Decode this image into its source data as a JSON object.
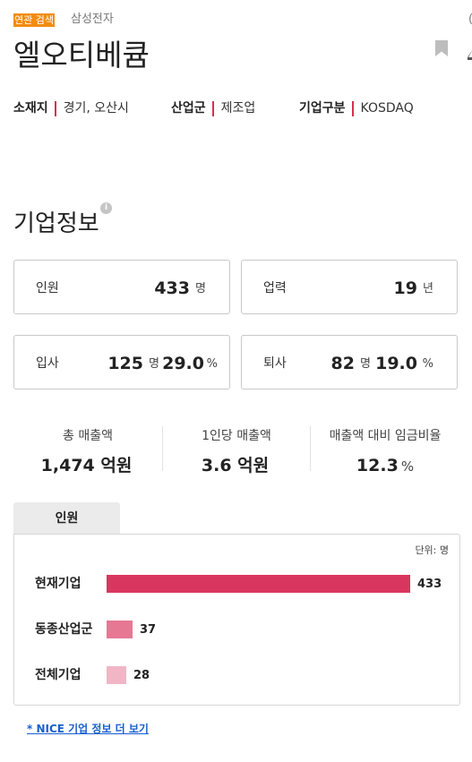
{
  "header": {
    "related_tag": "연관 검색",
    "related_company": "삼성전자",
    "cut_off_text": "(",
    "company_name": "엘오티베큠"
  },
  "meta": [
    {
      "key": "소재지",
      "value": "경기, 오산시"
    },
    {
      "key": "산업군",
      "value": "제조업"
    },
    {
      "key": "기업구분",
      "value": "KOSDAQ"
    }
  ],
  "company_info": {
    "title": "기업정보",
    "info_icon_glyph": "i",
    "boxes": {
      "employees": {
        "label": "인원",
        "value": "433",
        "unit": "명"
      },
      "years": {
        "label": "업력",
        "value": "19",
        "unit": "년"
      },
      "hired": {
        "label": "입사",
        "count": "125",
        "count_unit": "명",
        "rate": "29.0",
        "rate_unit": "%"
      },
      "left": {
        "label": "퇴사",
        "count": "82",
        "count_unit": "명",
        "rate": "19.0",
        "rate_unit": "%"
      }
    }
  },
  "finance": [
    {
      "label": "총 매출액",
      "value": "1,474 억원",
      "unit": ""
    },
    {
      "label": "1인당 매출액",
      "value": "3.6 억원",
      "unit": ""
    },
    {
      "label": "매출액 대비 임금비율",
      "value": "12.3",
      "unit": "%"
    }
  ],
  "chart_tab": "인원",
  "chart_data": {
    "type": "bar",
    "unit_note": "단위: 명",
    "categories": [
      "현재기업",
      "동종산업군",
      "전체기업"
    ],
    "values": [
      433,
      37,
      28
    ],
    "value_labels": [
      "433",
      "37",
      "28"
    ],
    "colors": [
      "#d9365f",
      "#e67894",
      "#f0b6c6"
    ],
    "xlim": [
      0,
      433
    ]
  },
  "more_link": "* NICE 기업 정보 더 보기",
  "colors": {
    "accent": "#d3304f",
    "tag_orange": "#f28c0f",
    "link_blue": "#1a5fd0"
  }
}
